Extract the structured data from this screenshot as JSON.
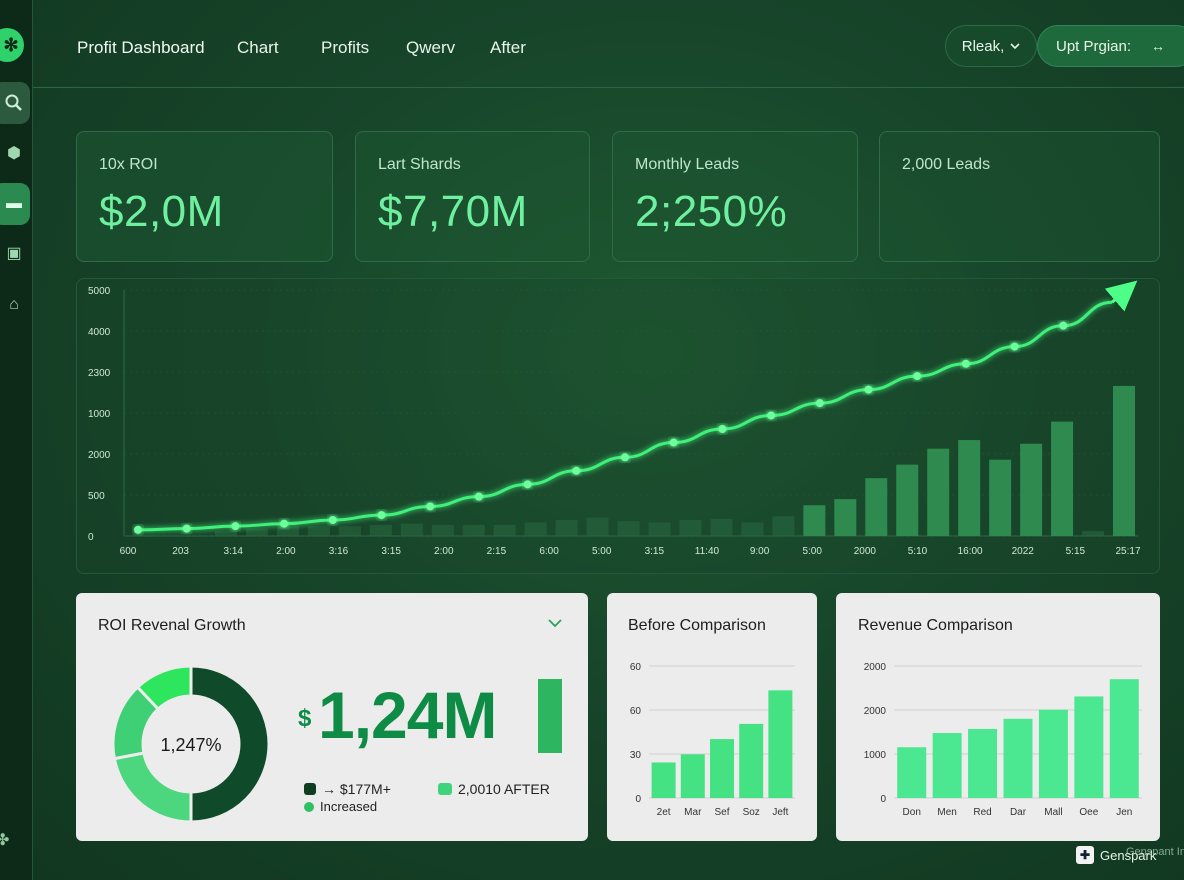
{
  "sidebar": {
    "icons": [
      "gear-icon",
      "search-icon",
      "box-icon",
      "chart-icon",
      "grid-icon",
      "bank-icon",
      "apps-icon"
    ]
  },
  "header": {
    "title": "Profit Dashboard",
    "nav": [
      "Chart",
      "Profits",
      "Qwerv",
      "After"
    ],
    "select_value": "Rleak,",
    "button_label": "Upt Prgian:"
  },
  "kpis": [
    {
      "label": "10x ROI",
      "value": "$2,0M"
    },
    {
      "label": "Lart Shards",
      "value": "$7,70M"
    },
    {
      "label": "Monthly Leads",
      "value": "2;250%"
    },
    {
      "label": "2,000 Leads",
      "value": ""
    }
  ],
  "chart_data": [
    {
      "type": "line",
      "title": "",
      "y_ticks": [
        "5000",
        "4000",
        "2300",
        "1000",
        "2000",
        "500",
        "0"
      ],
      "x_ticks": [
        "600",
        "203",
        "3:14",
        "2:00",
        "3:16",
        "3:15",
        "2:00",
        "2:15",
        "6:00",
        "5:00",
        "3:15",
        "11:40",
        "9:00",
        "5:00",
        "2000",
        "5:10",
        "16:00",
        "2022",
        "5:15",
        "25:17"
      ],
      "series": [
        {
          "values": [
            0.05,
            0.06,
            0.08,
            0.1,
            0.13,
            0.17,
            0.24,
            0.32,
            0.42,
            0.53,
            0.64,
            0.76,
            0.87,
            0.98,
            1.08,
            1.19,
            1.3,
            1.4,
            1.54,
            1.71,
            1.9
          ]
        }
      ],
      "bars": [
        0.04,
        0.06,
        0.08,
        0.08,
        0.08,
        0.09,
        0.1,
        0.09,
        0.09,
        0.09,
        0.11,
        0.13,
        0.15,
        0.12,
        0.11,
        0.13,
        0.14,
        0.11,
        0.16,
        0.25,
        0.3,
        0.47,
        0.58,
        0.71,
        0.78,
        0.62,
        0.75,
        0.93,
        0.04,
        1.22
      ]
    },
    {
      "type": "pie",
      "title": "ROI Revenal Growth",
      "center_label": "1,247%",
      "slices": [
        {
          "value": 50,
          "color": "#0f4a2a"
        },
        {
          "value": 22,
          "color": "#4cd77f"
        },
        {
          "value": 16,
          "color": "#3fcf74"
        },
        {
          "value": 12,
          "color": "#2ee65e"
        }
      ]
    },
    {
      "type": "bar",
      "title": "Before Comparison",
      "y_ticks": [
        "60",
        "60",
        "30",
        "0"
      ],
      "categories": [
        "2et",
        "Mar",
        "Sef",
        "Soz",
        "Jeft"
      ],
      "values": [
        35,
        43,
        58,
        73,
        106
      ],
      "ylim": [
        0,
        130
      ]
    },
    {
      "type": "bar",
      "title": "Revenue Comparison",
      "y_ticks": [
        "2000",
        "2000",
        "1000",
        "0"
      ],
      "categories": [
        "Don",
        "Men",
        "Red",
        "Dar",
        "Mall",
        "Oee",
        "Jen"
      ],
      "values": [
        500,
        640,
        680,
        780,
        870,
        1000,
        1170
      ],
      "ylim": [
        0,
        1300
      ]
    }
  ],
  "roi_card": {
    "big_value": "1,24M",
    "currency": "$",
    "legend": [
      {
        "label": "→ $177M+",
        "color": "#0f3d22"
      },
      {
        "label": "Increased",
        "color": "#2ec065"
      },
      {
        "label": "2,0010  AFTER",
        "color": "#3fd37b"
      }
    ]
  },
  "footer": {
    "brand": "Genspark",
    "watermark": "Genspant In"
  },
  "colors": {
    "accent": "#3ef07a",
    "background": "#17452a",
    "card_light": "#ececec"
  }
}
